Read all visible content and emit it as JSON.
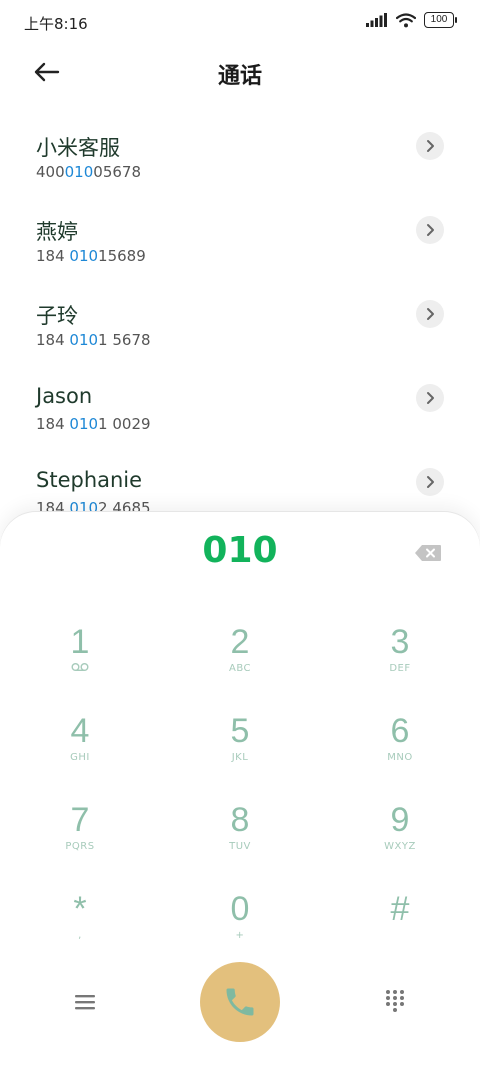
{
  "status": {
    "time": "上午8:16",
    "battery": "100"
  },
  "header": {
    "title": "通话"
  },
  "contacts": [
    {
      "name": "小米客服",
      "num_pre": "400",
      "num_hl": "010",
      "num_post": "05678"
    },
    {
      "name": "燕婷",
      "num_pre": "184 ",
      "num_hl": "010",
      "num_post": "15689"
    },
    {
      "name": "子玲",
      "num_pre": "184 ",
      "num_hl": "010",
      "num_post": "1 5678"
    },
    {
      "name": "Jason",
      "num_pre": "184 ",
      "num_hl": "010",
      "num_post": "1 0029"
    },
    {
      "name": "Stephanie",
      "num_pre": "184 ",
      "num_hl": "010",
      "num_post": "2 4685"
    }
  ],
  "dialer": {
    "input": "010",
    "keys": [
      {
        "digit": "1",
        "letters": ""
      },
      {
        "digit": "2",
        "letters": "ABC"
      },
      {
        "digit": "3",
        "letters": "DEF"
      },
      {
        "digit": "4",
        "letters": "GHI"
      },
      {
        "digit": "5",
        "letters": "JKL"
      },
      {
        "digit": "6",
        "letters": "MNO"
      },
      {
        "digit": "7",
        "letters": "PQRS"
      },
      {
        "digit": "8",
        "letters": "TUV"
      },
      {
        "digit": "9",
        "letters": "WXYZ"
      },
      {
        "digit": "*",
        "letters": ","
      },
      {
        "digit": "0",
        "letters": "+"
      },
      {
        "digit": "#",
        "letters": ""
      }
    ]
  },
  "colors": {
    "accent_green": "#12b35b",
    "highlight_blue": "#1e88d6",
    "call_button": "#e3c07d",
    "key_digit": "#8fbfaa"
  }
}
